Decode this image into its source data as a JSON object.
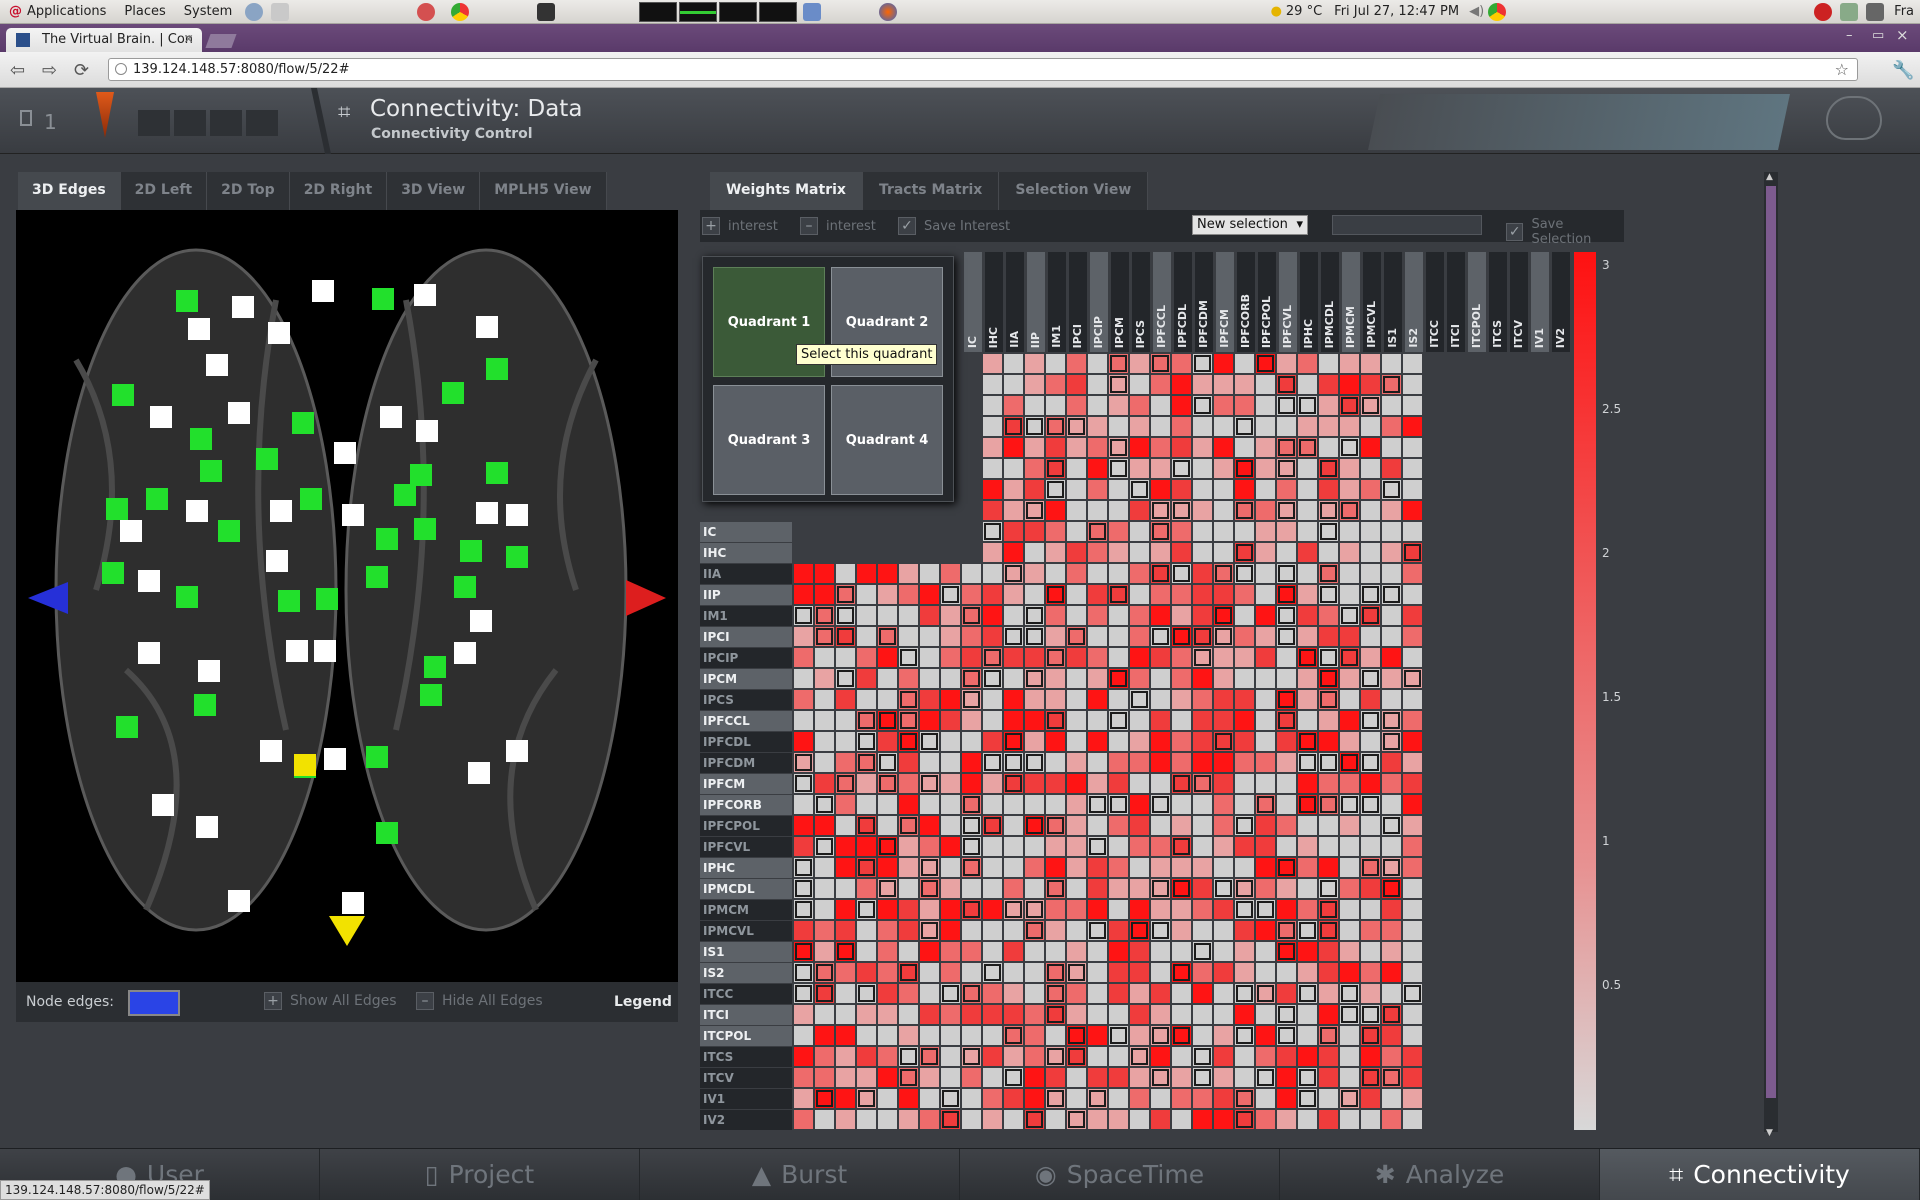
{
  "gnome": {
    "applications": "Applications",
    "places": "Places",
    "system": "System",
    "weather": "29 °C",
    "clock": "Fri Jul 27, 12:47 PM",
    "user": "Fra"
  },
  "browser": {
    "tab_title": "The Virtual Brain. | Con",
    "url": "139.124.148.57:8080/flow/5/22#",
    "status_url": "139.124.148.57:8080/flow/5/22#"
  },
  "header": {
    "project_count": "1",
    "title": "Connectivity: Data",
    "subtitle": "Connectivity Control"
  },
  "left_tabs": [
    "3D Edges",
    "2D Left",
    "2D Top",
    "2D Right",
    "3D View",
    "MPLH5 View"
  ],
  "viewer_footer": {
    "node_edges_label": "Node edges:",
    "node_edges_color": "#2a44e6",
    "show_all": "Show All Edges",
    "hide_all": "Hide All Edges",
    "legend": "Legend"
  },
  "right_tabs": [
    "Weights Matrix",
    "Tracts Matrix",
    "Selection View"
  ],
  "matrix_toolbar": {
    "add_interest": "interest",
    "remove_interest": "interest",
    "save_interest": "Save Interest",
    "selection_value": "New selection",
    "save_selection": "Save Selection"
  },
  "quadrants": [
    "Quadrant 1",
    "Quadrant 2",
    "Quadrant 3",
    "Quadrant 4"
  ],
  "tooltip": "Select this quadrant",
  "column_labels": [
    "IC",
    "IHC",
    "IIA",
    "IIP",
    "IM1",
    "IPCI",
    "IPCIP",
    "IPCM",
    "IPCS",
    "IPFCCL",
    "IPFCDL",
    "IPFCDM",
    "IPFCM",
    "IPFCORB",
    "IPFCPOL",
    "IPFCVL",
    "IPHC",
    "IPMCDL",
    "IPMCM",
    "IPMCVL",
    "IS1",
    "IS2",
    "ITCC",
    "ITCI",
    "ITCPOL",
    "ITCS",
    "ITCV",
    "IV1",
    "IV2"
  ],
  "row_labels": [
    "IC",
    "IHC",
    "IIA",
    "IIP",
    "IM1",
    "IPCI",
    "IPCIP",
    "IPCM",
    "IPCS",
    "IPFCCL",
    "IPFCDL",
    "IPFCDM",
    "IPFCM",
    "IPFCORB",
    "IPFCPOL",
    "IPFCVL",
    "IPHC",
    "IPMCDL",
    "IPMCM",
    "IPMCVL",
    "IS1",
    "IS2",
    "ITCC",
    "ITCI",
    "ITCPOL",
    "ITCS",
    "ITCV",
    "IV1",
    "IV2"
  ],
  "colorbar_ticks": [
    "3",
    "2.5",
    "2",
    "1.5",
    "1",
    "0.5"
  ],
  "bottom_nav": [
    "User",
    "Project",
    "Burst",
    "SpaceTime",
    "Analyze",
    "Connectivity"
  ]
}
